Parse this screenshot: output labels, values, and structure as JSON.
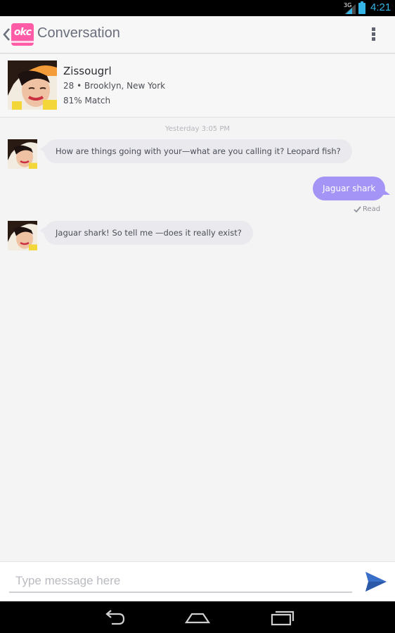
{
  "status_bar": {
    "network": "3G",
    "time": "4:21",
    "accent_color": "#35b5e5",
    "icons": [
      "signal-icon",
      "battery-charging-icon"
    ]
  },
  "action_bar": {
    "logo_text": "okc",
    "title": "Conversation",
    "icons": [
      "back-chevron-icon",
      "overflow-menu-icon"
    ]
  },
  "profile": {
    "name": "Zissougrl",
    "location": "28 • Brooklyn, New York",
    "match": "81% Match"
  },
  "conversation": {
    "timestamp": "Yesterday 3:05 PM",
    "messages": [
      {
        "from": "them",
        "text": "How are things going with your—what are you calling it? Leopard fish?"
      },
      {
        "from": "me",
        "text": "Jaguar shark",
        "status": "Read"
      },
      {
        "from": "them",
        "text": "Jaguar shark! So tell me —does it really exist?"
      }
    ],
    "incoming_bubble_color": "#e9e9ee",
    "outgoing_bubble_color": "#a494f5"
  },
  "composer": {
    "placeholder": "Type message here",
    "value": "",
    "send_icon": "send-icon",
    "send_color": "#3a6fc9"
  },
  "nav_bar": {
    "icons": [
      "back-icon",
      "home-icon",
      "recent-apps-icon"
    ]
  }
}
